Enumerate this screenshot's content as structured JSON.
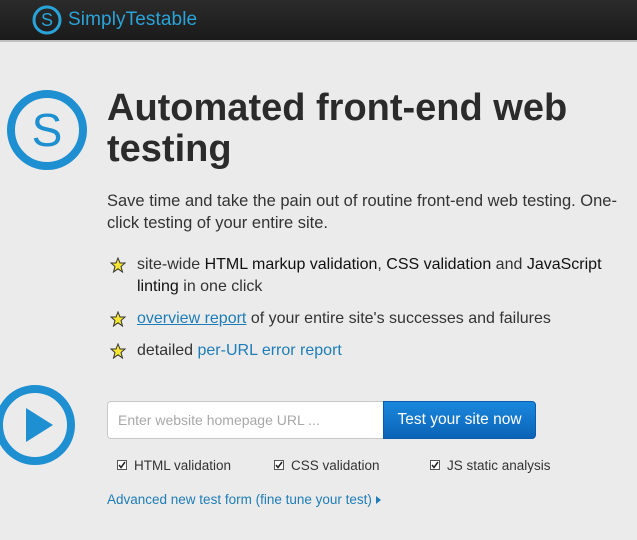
{
  "brand": {
    "name": "SimplyTestable"
  },
  "hero": {
    "title": "Automated front-end web testing",
    "lead": "Save time and take the pain out of routine front-end web testing. One-click testing of your entire site."
  },
  "features": [
    {
      "parts": [
        "site-wide ",
        "HTML markup validation",
        ", ",
        "CSS validation",
        " and ",
        "JavaScript linting",
        " in one click"
      ]
    },
    {
      "link": "overview report",
      "rest": " of your entire site's successes and failures"
    },
    {
      "prefix": "detailed ",
      "link": "per-URL error report"
    }
  ],
  "form": {
    "placeholder": "Enter website homepage URL ...",
    "submit_label": "Test your site now",
    "options": [
      {
        "label": "HTML validation",
        "checked": true
      },
      {
        "label": "CSS validation",
        "checked": true
      },
      {
        "label": "JS static analysis",
        "checked": true
      }
    ],
    "advanced_link": "Advanced new test form (fine tune your test)"
  },
  "colors": {
    "accent": "#1e7db8",
    "brand": "#2aa3d8",
    "button": "#0b63b6"
  },
  "icons": {
    "logo": "simplytestable-s-logo-icon",
    "feature": "star-icon",
    "start": "play-icon",
    "advanced": "caret-right-icon"
  }
}
